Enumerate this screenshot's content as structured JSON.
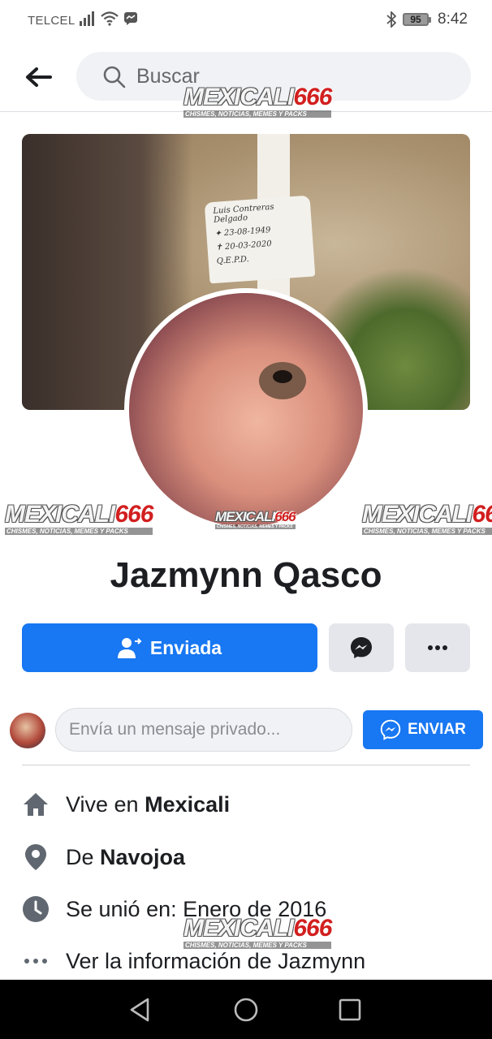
{
  "status_bar": {
    "carrier": "TELCEL",
    "battery": "95",
    "time": "8:42"
  },
  "search": {
    "placeholder": "Buscar"
  },
  "watermark": {
    "brand_main": "MEXICALI",
    "brand_num": "666",
    "brand_sub": "CHISMES, NOTICIAS, MEMES Y PACKS"
  },
  "cover": {
    "grave_text": [
      "Luis Contreras Delgado",
      "✦ 23-08-1949",
      "✝ 20-03-2020",
      "Q.E.P.D."
    ]
  },
  "profile": {
    "name": "Jazmynn Qasco"
  },
  "actions": {
    "primary_label": "Enviada"
  },
  "message": {
    "placeholder": "Envía un mensaje privado...",
    "send_label": "ENVIAR"
  },
  "info": {
    "lives_prefix": "Vive en ",
    "lives_value": "Mexicali",
    "from_prefix": "De ",
    "from_value": "Navojoa",
    "joined": "Se unió en: Enero de 2016",
    "more_info": "Ver la información de Jazmynn"
  },
  "colors": {
    "accent": "#1877f2",
    "gray_button": "#e4e6eb"
  }
}
